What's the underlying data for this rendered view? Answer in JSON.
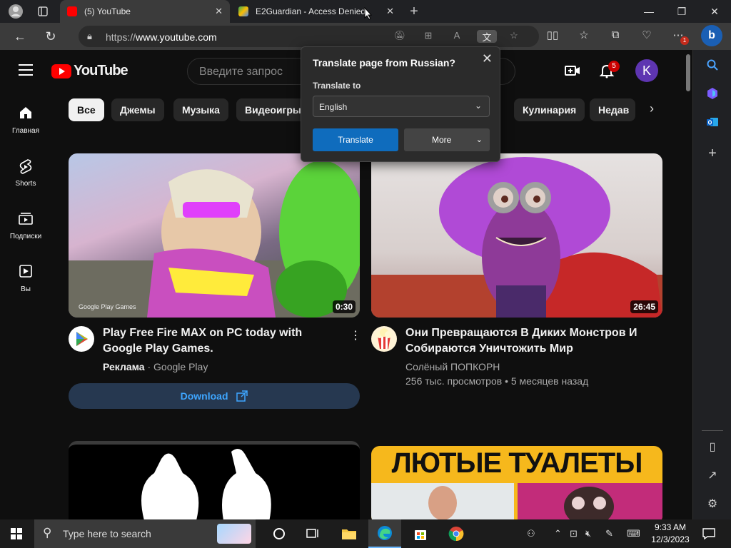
{
  "browser": {
    "tabs": [
      {
        "title": "(5) YouTube",
        "active": true
      },
      {
        "title": "E2Guardian - Access Denied",
        "active": false
      }
    ],
    "url": {
      "prefix": "https://",
      "host": "www.youtube.com"
    },
    "profile_badge": "1"
  },
  "translate_popup": {
    "title": "Translate page from Russian?",
    "translate_to_label": "Translate to",
    "language": "English",
    "translate_button": "Translate",
    "more_button": "More"
  },
  "youtube": {
    "logo_text": "YouTube",
    "search_placeholder": "Введите запрос",
    "notifications_count": "5",
    "avatar_letter": "K",
    "chips": [
      "Все",
      "Джемы",
      "Музыка",
      "Видеоигры",
      "Кулинария",
      "Недав"
    ],
    "left_nav": [
      {
        "icon": "home-icon",
        "label": "Главная"
      },
      {
        "icon": "shorts-icon",
        "label": "Shorts"
      },
      {
        "icon": "subscriptions-icon",
        "label": "Подписки"
      },
      {
        "icon": "you-icon",
        "label": "Вы"
      }
    ],
    "videos": [
      {
        "title": "Play Free Fire MAX on PC today with Google Play Games.",
        "ad_label": "Реклама",
        "channel": "Google Play",
        "duration": "0:30",
        "watermark": "Google Play Games",
        "cta": "Download"
      },
      {
        "title": "Они Превращаются В Диких Монстров И Собираются Уничтожить Мир",
        "channel": "Солёный ПОПКОРН",
        "stats": "256 тыс. просмотров • 5 месяцев назад",
        "duration": "26:45"
      },
      {
        "title": "",
        "banner_text": ""
      },
      {
        "banner_text": "ЛЮТЫЕ ТУАЛЕТЫ"
      }
    ]
  },
  "taskbar": {
    "search_placeholder": "Type here to search",
    "time": "9:33 AM",
    "date": "12/3/2023"
  }
}
